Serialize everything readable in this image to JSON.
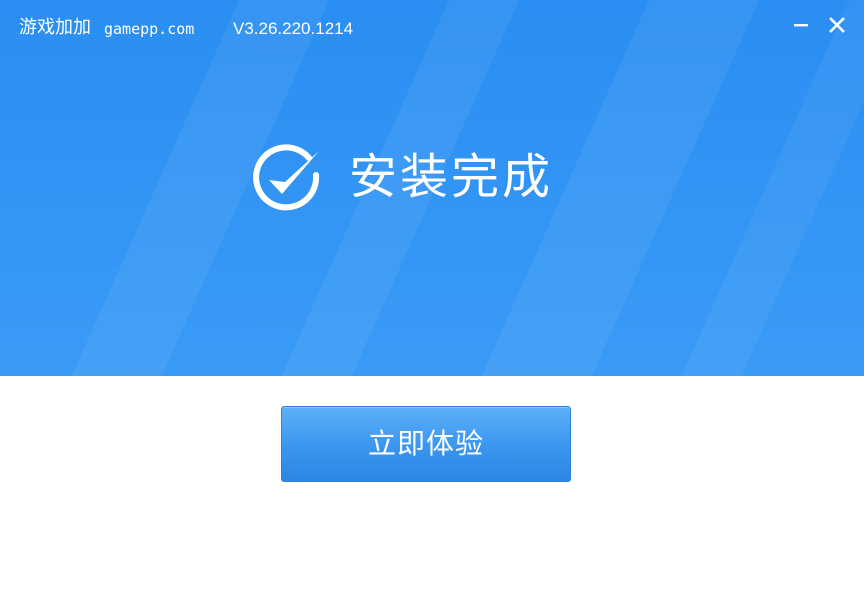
{
  "titlebar": {
    "app_name": "游戏加加",
    "site": "gamepp.com",
    "version": "V3.26.220.1214",
    "minimize_icon": "minimize-icon",
    "close_icon": "close-icon"
  },
  "status": {
    "icon": "check-circle-icon",
    "title": "安装完成"
  },
  "actions": {
    "start_label": "立即体验"
  },
  "colors": {
    "header_blue": "#2a8ef2",
    "button_blue": "#3a95ee",
    "background": "#ffffff"
  }
}
